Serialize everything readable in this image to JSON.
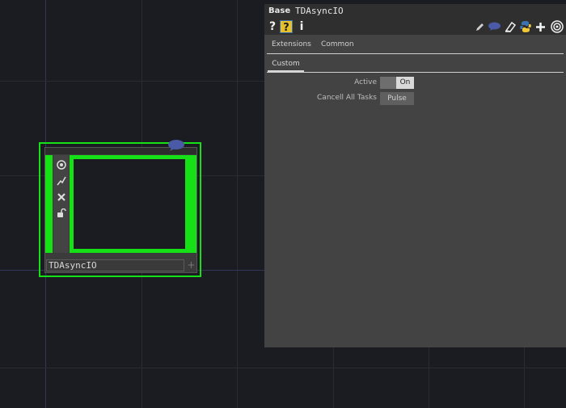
{
  "node": {
    "name": "TDAsyncIO",
    "icons": [
      "viewer-active-icon",
      "bypass-icon",
      "close-icon",
      "lock-icon"
    ],
    "add_label": "+"
  },
  "panel": {
    "op_type": "Base",
    "op_name": "TDAsyncIO",
    "toolbar": {
      "help": "?",
      "python_help": "?",
      "info": "i"
    },
    "tabs_row1": [
      "Extensions",
      "Common"
    ],
    "active_tab": "Custom",
    "params": {
      "active_label": "Active",
      "active_value": "On",
      "cancel_label": "Cancell All Tasks",
      "cancel_button": "Pulse"
    }
  },
  "colors": {
    "selection": "#16e016",
    "background": "#1b1c21",
    "panel": "#434343"
  }
}
